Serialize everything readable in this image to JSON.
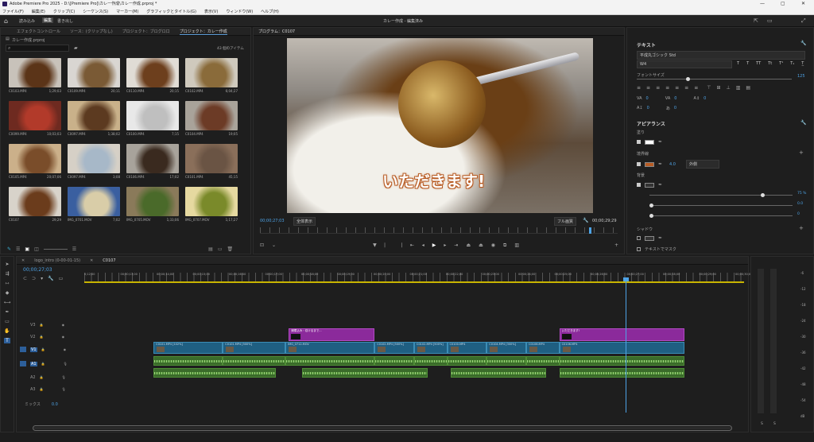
{
  "window": {
    "title": "Adobe Premiere Pro 2025 - D:\\[Premiere Pro]\\カレー作成\\カレー作成.prproj *",
    "min": "—",
    "max": "▢",
    "close": "✕"
  },
  "menu": [
    "ファイル(F)",
    "編集(E)",
    "クリップ(C)",
    "シーケンス(S)",
    "マーカー(M)",
    "グラフィックとタイトル(G)",
    "表示(V)",
    "ウィンドウ(W)",
    "ヘルプ(H)"
  ],
  "appbar": {
    "tabs": [
      "読み込み",
      "編集",
      "書き出し"
    ],
    "center": "カレー作成 - 編集済み"
  },
  "project_panel": {
    "tabs": [
      "エフェクトコントロール",
      "ソース：(クリップなし)",
      "プロジェクト：ブログロ口",
      "プロジェクト：カレー作成"
    ],
    "bin": "カレー作成.prproj",
    "item_count": "43 個のアイテム",
    "items": [
      {
        "name": "C0103.MP4",
        "dur": "1;29;03",
        "c1": "#c8c2ba",
        "c2": "#5b3418"
      },
      {
        "name": "C0109.MP4",
        "dur": "20;11",
        "c1": "#d9d6d2",
        "c2": "#7a5a35"
      },
      {
        "name": "C0110.MP4",
        "dur": "20;15",
        "c1": "#e0dcd5",
        "c2": "#6d3f1d"
      },
      {
        "name": "C0102.MP4",
        "dur": "6;04;27",
        "c1": "#cfc9bd",
        "c2": "#8a6b3a"
      },
      {
        "name": "C0099.MP4",
        "dur": "10;03;03",
        "c1": "#6e2a20",
        "c2": "#b23a2a"
      },
      {
        "name": "C0097.MP4",
        "dur": "1;38;02",
        "c1": "#c9b18a",
        "c2": "#5c3a20"
      },
      {
        "name": "C0100.MP4",
        "dur": "7;15",
        "c1": "#e8e8e8",
        "c2": "#bfbfbf"
      },
      {
        "name": "C0104.MP4",
        "dur": "19;05",
        "c1": "#a9a39a",
        "c2": "#6c3b26"
      },
      {
        "name": "C0105.MP4",
        "dur": "20;07;06",
        "c1": "#cbb08a",
        "c2": "#7a4d2a"
      },
      {
        "name": "C0097.MP4",
        "dur": "3;08",
        "c1": "#d6d0c6",
        "c2": "#a7b8c8"
      },
      {
        "name": "C0106.MP4",
        "dur": "17;02",
        "c1": "#a8a39b",
        "c2": "#3a2a1f"
      },
      {
        "name": "C0101.MP4",
        "dur": "45;15",
        "c1": "#8a6f5a",
        "c2": "#6a5444"
      },
      {
        "name": "C0107",
        "dur": "29;29",
        "c1": "#d8d3ca",
        "c2": "#6b3c1c"
      },
      {
        "name": "IMG_0701.MOV",
        "dur": "7;02",
        "c1": "#3a5fa0",
        "c2": "#d9cda8"
      },
      {
        "name": "IMG_0705.MOV",
        "dur": "1;33;06",
        "c1": "#8a7a5a",
        "c2": "#4a6a2a"
      },
      {
        "name": "IMG_0707.MOV",
        "dur": "1;17;27",
        "c1": "#e6d9a0",
        "c2": "#7a8a2a"
      }
    ]
  },
  "program": {
    "tab": "プログラム：C0107",
    "caption": "いただきます!",
    "timecode": "00;00;27;03",
    "fit": "全体表示",
    "quality": "フル画質",
    "duration": "00;00;29;29"
  },
  "essential": {
    "header": "テキスト",
    "font": "平成丸ゴシック Std",
    "style": "W4",
    "font_size_label": "フォントサイズ",
    "font_size": "125",
    "tracking": "0",
    "leading": "0",
    "kerning": "0",
    "baseline": "0",
    "tsume": "0",
    "appearance": "アピアランス",
    "fill_label": "塗り",
    "fill_color": "#ffffff",
    "stroke_label": "境界線",
    "stroke_color": "#b85c24",
    "stroke_width": "4.0",
    "stroke_pos": "外側",
    "bg_label": "背景",
    "bg_opacity": "75 %",
    "bg_size": "0.0",
    "bg_round": "0",
    "shadow": "シャドウ",
    "mask": "テキストでマスク"
  },
  "timeline": {
    "tabs": [
      "logo_intro (0-00-01-15)",
      "C0107"
    ],
    "timecode": "00;00;27;03",
    "ruler": [
      "0;12;00",
      "00;00;13;00",
      "00;00;14;00",
      "00;00;15;00",
      "00;00;16;00",
      "00;00;17;00",
      "00;00;18;00",
      "00;00;19;00",
      "00;00;20;00",
      "00;00;21;00",
      "00;00;22;00",
      "00;00;23;00",
      "00;00;24;00",
      "00;00;25;00",
      "00;00;26;00",
      "00;00;27;00",
      "00;00;28;00",
      "00;00;29;00",
      "00;00;30;00"
    ],
    "tracks": [
      "V3",
      "V2",
      "V1",
      "A1",
      "A2",
      "A3"
    ],
    "mix": "ミックス",
    "mix_val": "0.0",
    "text_clips": [
      {
        "label": "鍋煮込み・炊けるまで...",
        "start": 0.31,
        "end": 0.44
      },
      {
        "label": "いただきます!",
        "start": 0.72,
        "end": 0.91
      }
    ],
    "video_clips": [
      {
        "label": "C0101.MP4 [102%]",
        "start": 0.105,
        "end": 0.21
      },
      {
        "label": "C0101.MP4 [500%]",
        "start": 0.21,
        "end": 0.305
      },
      {
        "label": "IMG_0712.MOV",
        "start": 0.305,
        "end": 0.44
      },
      {
        "label": "C0102.MP4 [500%]",
        "start": 0.44,
        "end": 0.5
      },
      {
        "label": "C0102.MP4 [500%]",
        "start": 0.5,
        "end": 0.55
      },
      {
        "label": "C0100.MP4",
        "start": 0.55,
        "end": 0.61
      },
      {
        "label": "C0104.MP4 [300%]",
        "start": 0.61,
        "end": 0.67
      },
      {
        "label": "C0106.MP4",
        "start": 0.67,
        "end": 0.72
      },
      {
        "label": "C0106.MP4",
        "start": 0.72,
        "end": 0.91
      }
    ],
    "meter": [
      "-6",
      "-12",
      "-18",
      "-24",
      "-30",
      "-36",
      "-42",
      "-48",
      "-54",
      "dB"
    ],
    "meter_ss": [
      "S",
      "S"
    ]
  }
}
